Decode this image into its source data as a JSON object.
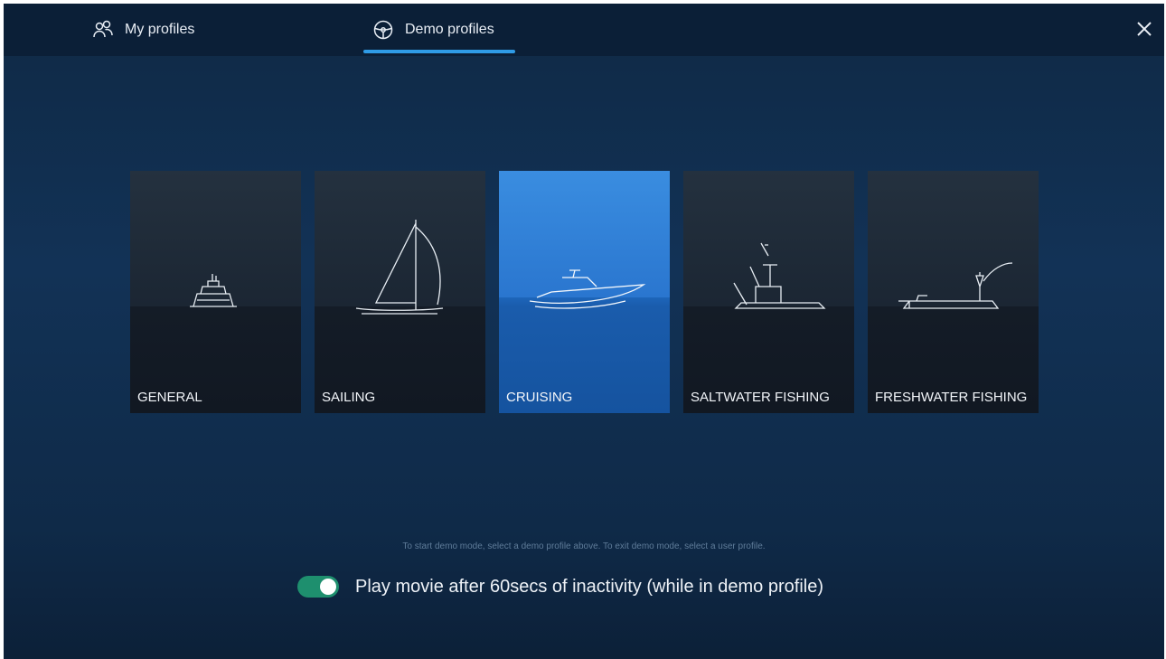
{
  "tabs": {
    "my_profiles": {
      "label": "My profiles",
      "icon": "users-icon"
    },
    "demo_profiles": {
      "label": "Demo profiles",
      "icon": "steering-wheel-icon",
      "active": true
    }
  },
  "close": {
    "icon": "close-icon"
  },
  "cards": [
    {
      "label": "GENERAL",
      "icon": "motorboat-icon",
      "selected": false
    },
    {
      "label": "SAILING",
      "icon": "sailboat-icon",
      "selected": false
    },
    {
      "label": "CRUISING",
      "icon": "cruiser-icon",
      "selected": true
    },
    {
      "label": "SALTWATER FISHING",
      "icon": "sportfisher-icon",
      "selected": false
    },
    {
      "label": "FRESHWATER FISHING",
      "icon": "angler-boat-icon",
      "selected": false
    }
  ],
  "hint": "To start demo mode, select a demo profile above. To exit demo mode, select a user profile.",
  "movie_toggle": {
    "label": "Play movie after 60secs of inactivity (while in demo profile)",
    "on": true
  },
  "colors": {
    "accent": "#2f9be6",
    "toggle_on": "#1e8f6e",
    "selected_card": "#2a76cf"
  }
}
